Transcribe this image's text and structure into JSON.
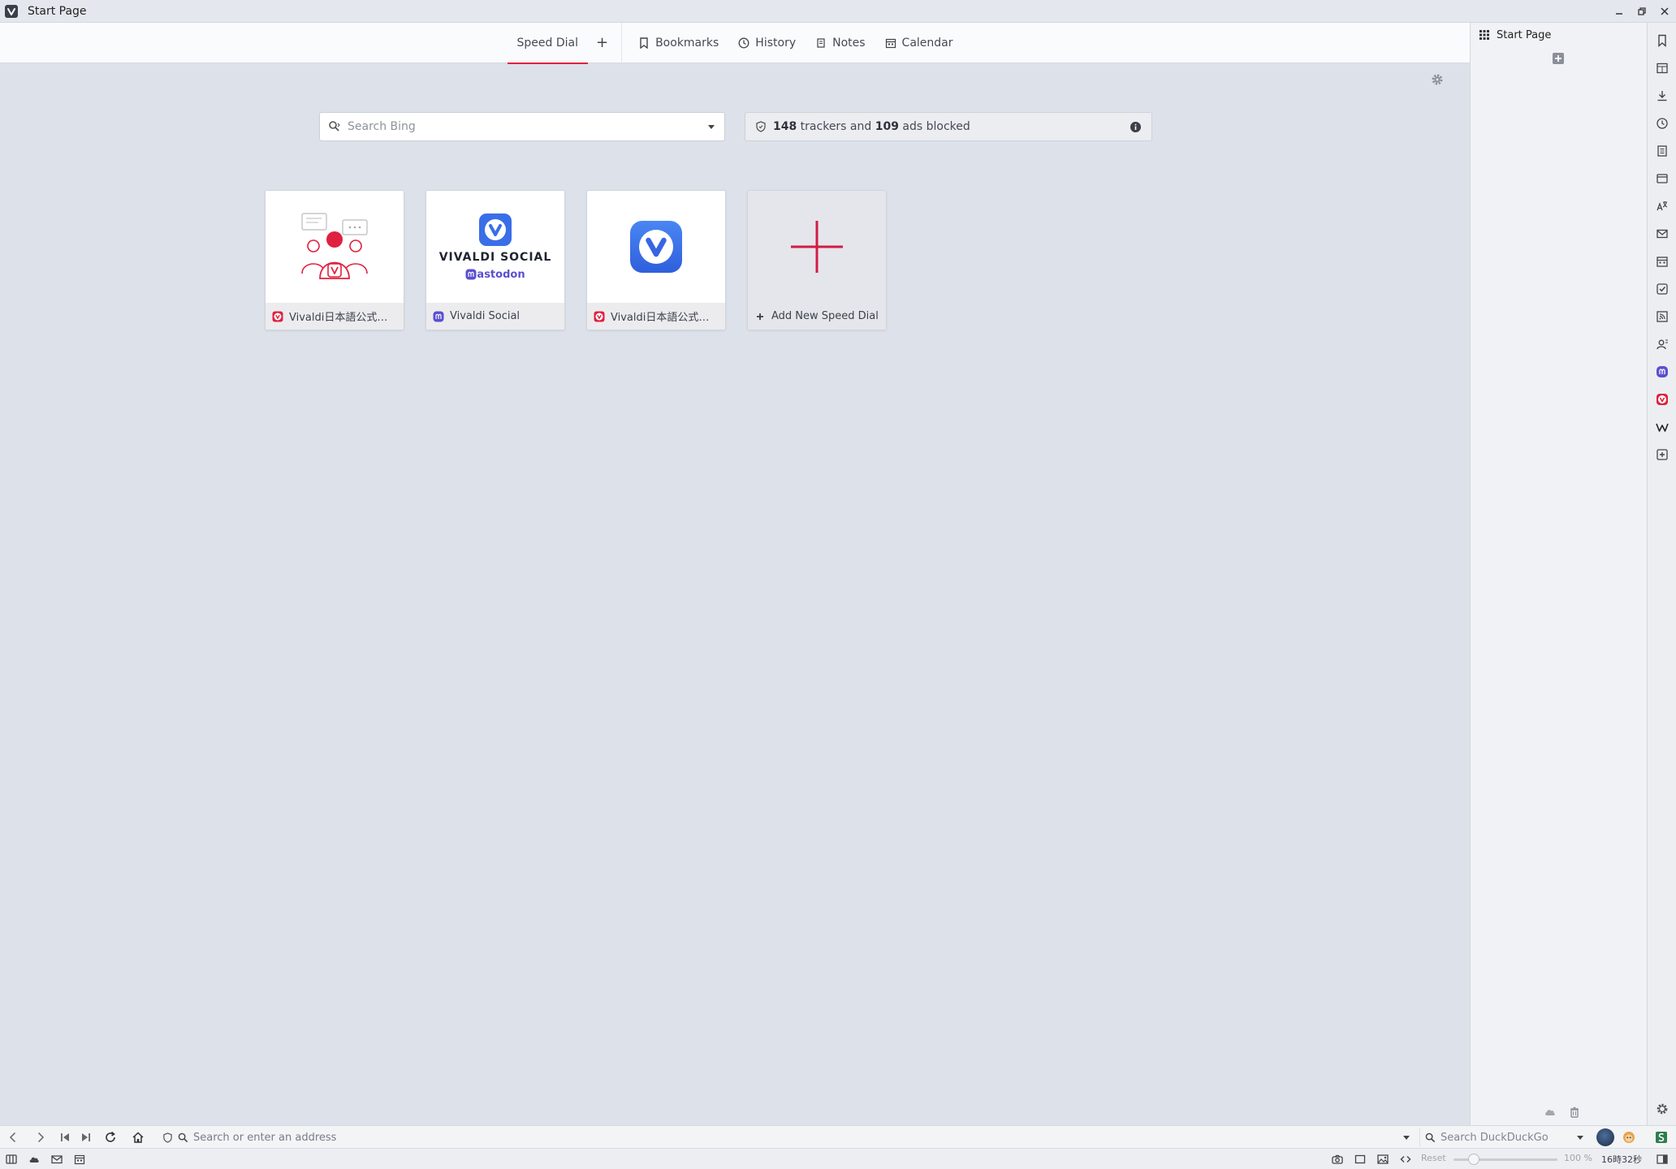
{
  "window": {
    "title": "Start Page",
    "controls": [
      "minimize",
      "restore",
      "close"
    ]
  },
  "start_page": {
    "nav": {
      "tabs": [
        {
          "label": "Speed Dial",
          "active": true
        },
        {
          "label": "Bookmarks",
          "icon": "bookmark-icon"
        },
        {
          "label": "History",
          "icon": "clock-icon"
        },
        {
          "label": "Notes",
          "icon": "notes-icon"
        },
        {
          "label": "Calendar",
          "icon": "calendar-icon"
        }
      ],
      "add_label": "+"
    },
    "search": {
      "placeholder": "Search Bing",
      "value": ""
    },
    "blocker": {
      "trackers_count": "148",
      "trackers_text": " trackers and ",
      "ads_count": "109",
      "ads_text": " ads blocked"
    },
    "speed_dials": [
      {
        "title": "Vivaldi日本語公式ブ…",
        "favicon": "vivaldi-icon"
      },
      {
        "title": "Vivaldi Social",
        "favicon": "mastodon-icon",
        "thumb_title": "VIVALDI SOCIAL",
        "thumb_subtitle": "astodon"
      },
      {
        "title": "Vivaldi日本語公式ブ…",
        "favicon": "vivaldi-icon"
      },
      {
        "title": "Add New Speed Dial",
        "icon": "plus-icon"
      }
    ],
    "accent_color": "#e0203f"
  },
  "side_panel": {
    "title": "Start Page"
  },
  "address_bar": {
    "url_placeholder": "Search or enter an address",
    "url_value": "",
    "search_placeholder": "Search DuckDuckGo"
  },
  "status_bar": {
    "reset_label": "Reset",
    "zoom": "100 %",
    "clock": "16時32秒"
  }
}
